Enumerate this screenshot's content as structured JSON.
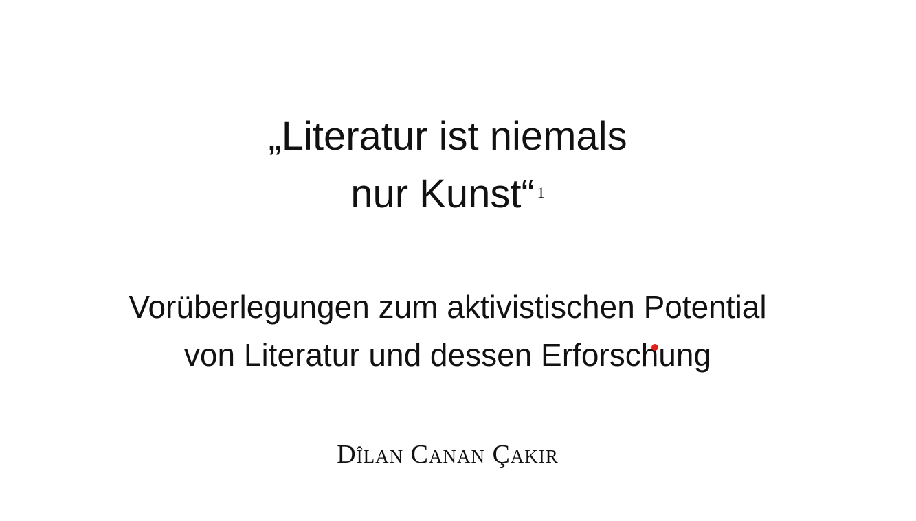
{
  "title": {
    "line1": "„Literatur ist niemals",
    "line2": "nur Kunst“",
    "footnote_marker": "1"
  },
  "subtitle": {
    "line1": "Vorüberlegungen zum aktivistischen Potential",
    "line2": "von Literatur und dessen Erforschung"
  },
  "author": "Dîlan Canan Çakir",
  "colors": {
    "text": "#111111",
    "background": "#ffffff",
    "cursor": "#e0201a"
  }
}
